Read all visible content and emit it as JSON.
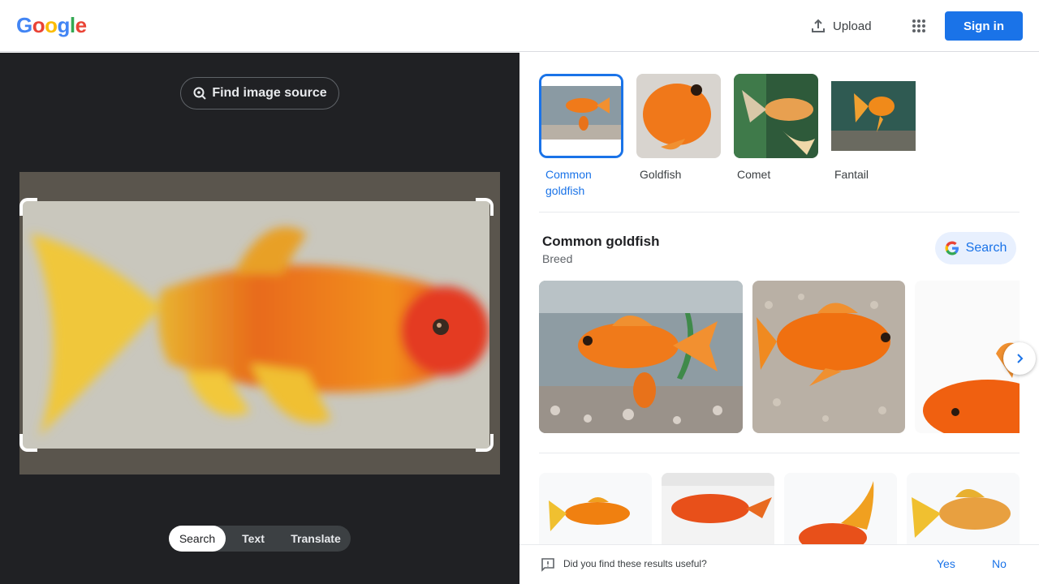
{
  "header": {
    "logo_letters": [
      "G",
      "o",
      "o",
      "g",
      "l",
      "e"
    ],
    "logo_colors": [
      "#4285f4",
      "#ea4335",
      "#fbbc05",
      "#4285f4",
      "#34a853",
      "#ea4335"
    ],
    "upload_label": "Upload",
    "signin_label": "Sign in"
  },
  "left": {
    "find_source_label": "Find image source",
    "tabs": [
      {
        "label": "Search",
        "active": true
      },
      {
        "label": "Text",
        "active": false
      },
      {
        "label": "Translate",
        "active": false
      }
    ]
  },
  "right": {
    "chips": [
      {
        "label": "Common goldfish",
        "selected": true
      },
      {
        "label": "Goldfish",
        "selected": false
      },
      {
        "label": "Comet",
        "selected": false
      },
      {
        "label": "Fantail",
        "selected": false
      }
    ],
    "knowledge": {
      "title": "Common goldfish",
      "subtitle": "Breed",
      "search_label": "Search"
    },
    "feedback": {
      "question": "Did you find these results useful?",
      "yes": "Yes",
      "no": "No"
    }
  },
  "colors": {
    "accent": "#1a73e8",
    "dark_bg": "#202124",
    "fish_orange": "#f07a1a"
  }
}
